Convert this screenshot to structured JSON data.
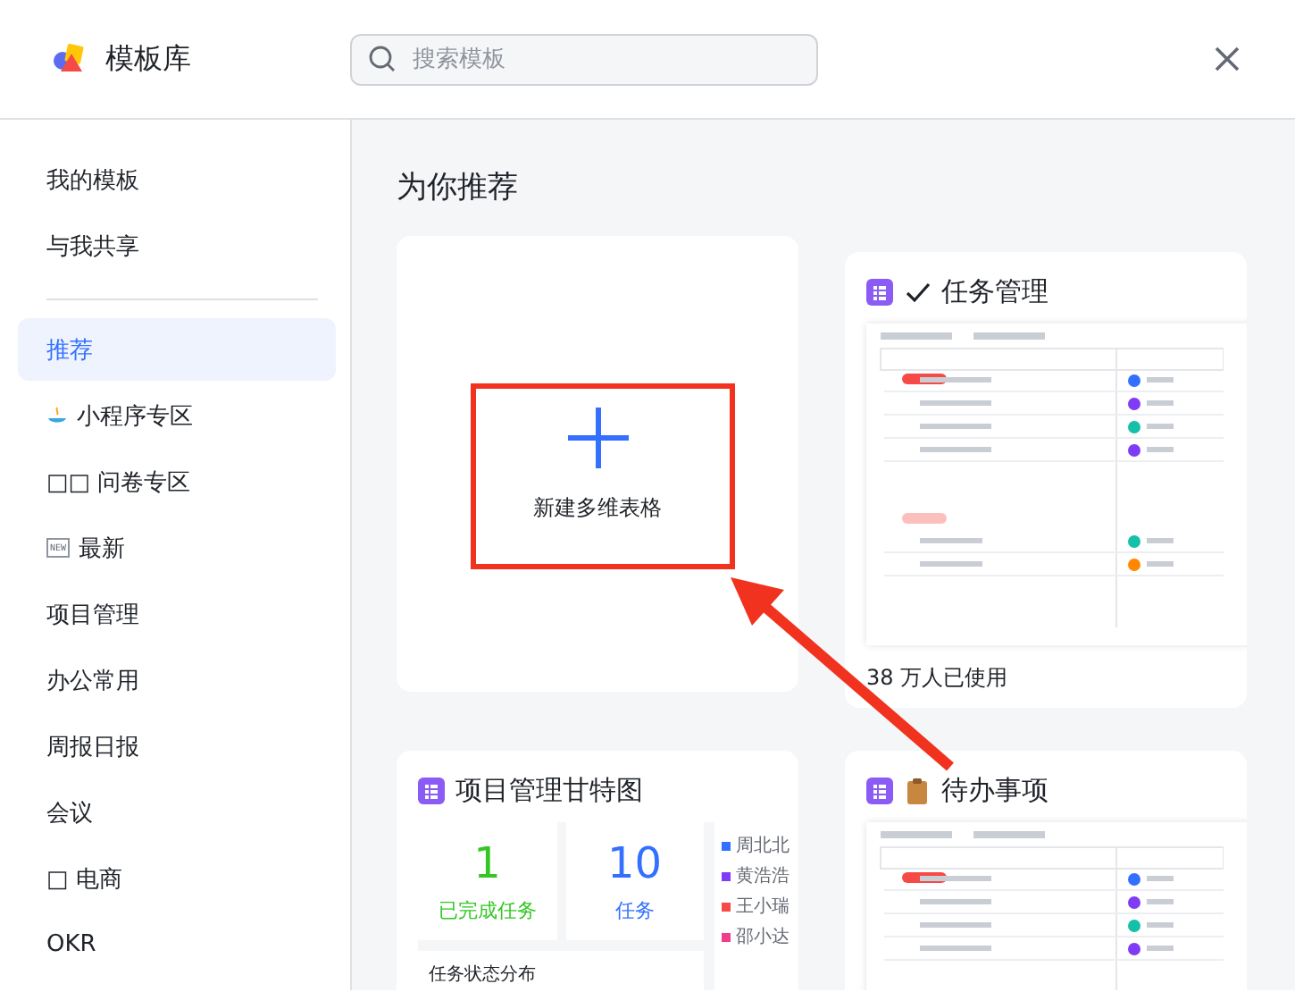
{
  "header": {
    "title": "模板库",
    "search": {
      "placeholder": "搜索模板"
    }
  },
  "sidebar": {
    "items": [
      {
        "label": "我的模板",
        "kind": "plain",
        "selected": false
      },
      {
        "label": "与我共享",
        "kind": "plain",
        "selected": false
      },
      {
        "kind": "divider"
      },
      {
        "label": "推荐",
        "kind": "plain",
        "selected": true
      },
      {
        "label": "小程序专区",
        "kind": "icon",
        "selected": false
      },
      {
        "label": "□□ 问卷专区",
        "kind": "plain",
        "selected": false
      },
      {
        "label": "最新",
        "kind": "new",
        "badge": "NEW",
        "selected": false
      },
      {
        "label": "项目管理",
        "kind": "plain",
        "selected": false
      },
      {
        "label": "办公常用",
        "kind": "plain",
        "selected": false
      },
      {
        "label": "周报日报",
        "kind": "plain",
        "selected": false
      },
      {
        "label": "会议",
        "kind": "plain",
        "selected": false
      },
      {
        "label": "□ 电商",
        "kind": "plain",
        "selected": false
      },
      {
        "label": "OKR",
        "kind": "plain",
        "selected": false
      }
    ]
  },
  "content": {
    "heading": "为你推荐",
    "columns": [
      [
        {
          "kind": "new",
          "label": "新建多维表格"
        },
        {
          "kind": "template",
          "title": "项目管理甘特图",
          "title_icon": {
            "kind": "none"
          },
          "preview": {
            "kind": "dashboard",
            "stats": [
              {
                "value": "1",
                "label": "已完成任务",
                "color": "#34c724"
              },
              {
                "value": "10",
                "label": "任务",
                "color": "#3370ff"
              }
            ],
            "legend": [
              {
                "name": "周北北",
                "color": "#3370ff"
              },
              {
                "name": "黄浩浩",
                "color": "#7f3bf5"
              },
              {
                "name": "王小瑞",
                "color": "#f54a45"
              },
              {
                "name": "邵小达",
                "color": "#f03c8c"
              }
            ],
            "panel_title": "任务状态分布"
          }
        }
      ],
      [
        {
          "kind": "template",
          "title": "任务管理",
          "title_icon": {
            "kind": "check"
          },
          "preview": {
            "kind": "table"
          },
          "usage": "38 万人已使用"
        },
        {
          "kind": "template",
          "title": "待办事项",
          "title_icon": {
            "kind": "clipboard"
          },
          "preview": {
            "kind": "table"
          }
        }
      ]
    ]
  },
  "annotation": {
    "highlight": true,
    "arrow": true
  }
}
